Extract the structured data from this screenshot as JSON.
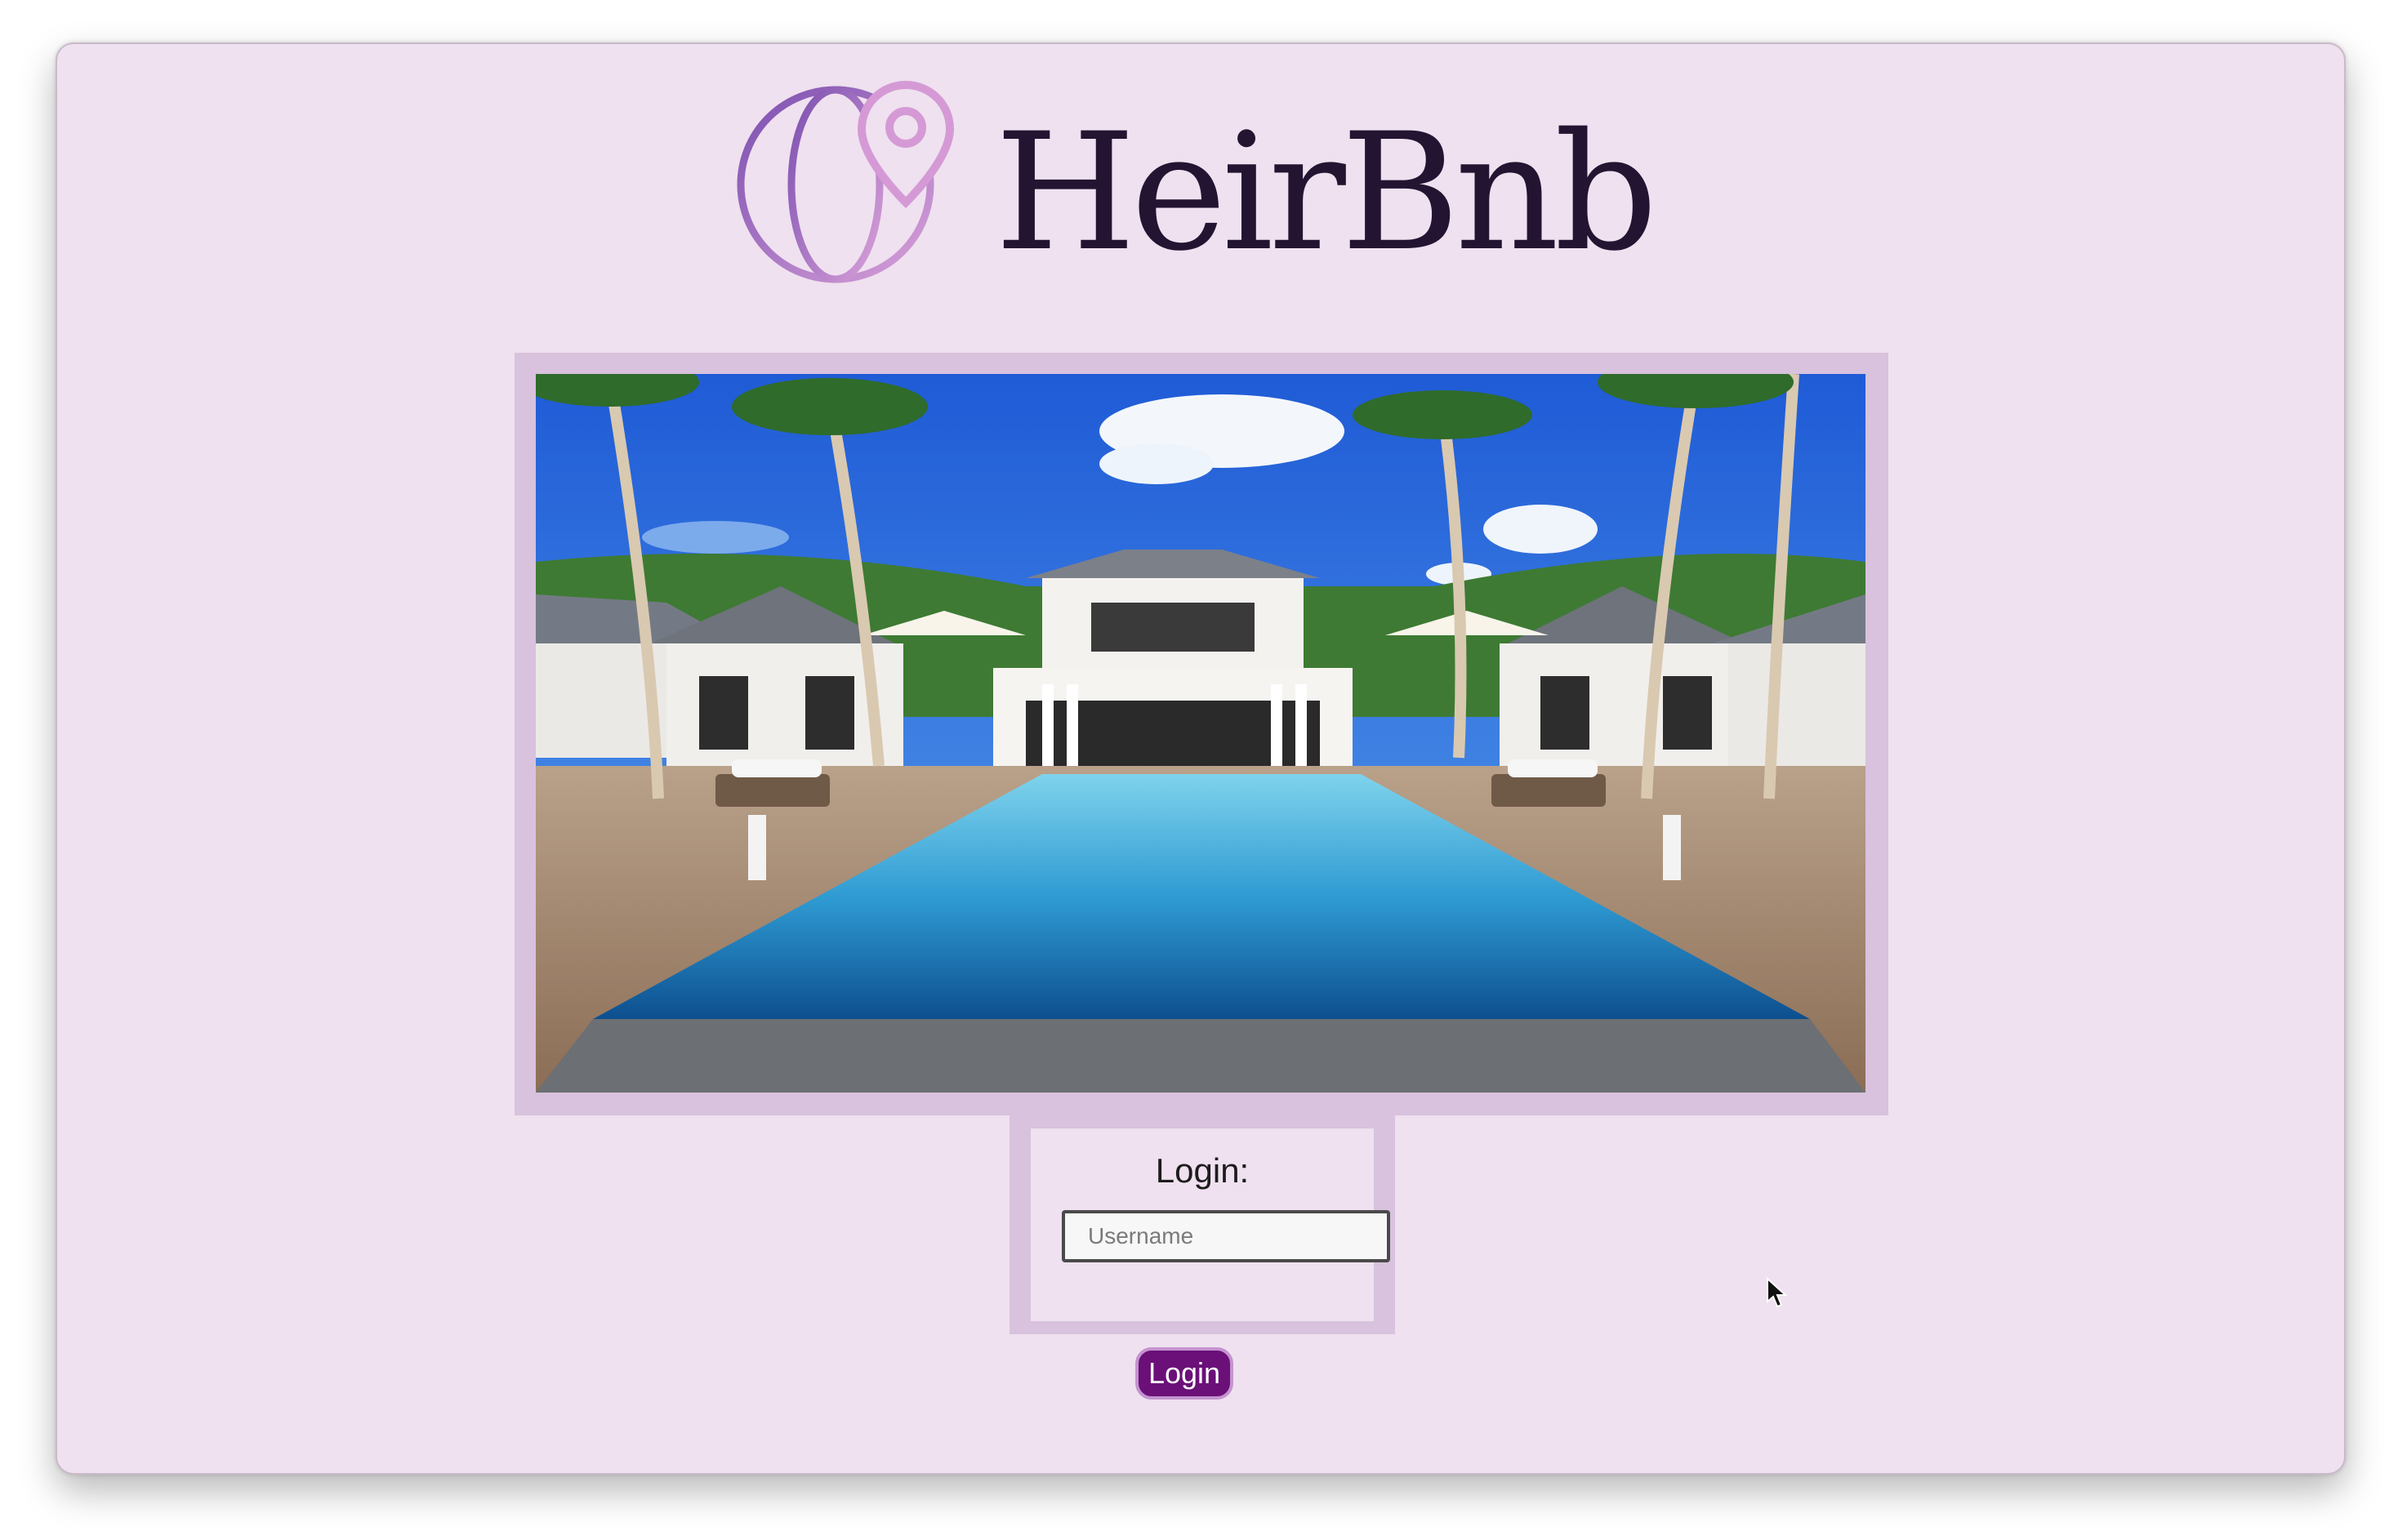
{
  "brand": {
    "name": "HeirBnb",
    "icon": "globe-pin-icon"
  },
  "hero": {
    "image": "villa-pool-photo"
  },
  "login": {
    "title": "Login:",
    "username_placeholder": "Username",
    "username_value": "",
    "button_label": "Login"
  },
  "colors": {
    "background": "#efe1ef",
    "frame": "#d8c2dd",
    "button": "#6a1078",
    "button_border": "#c493d0",
    "logo_text": "#231532"
  },
  "cursor": {
    "icon": "mouse-pointer-icon"
  }
}
